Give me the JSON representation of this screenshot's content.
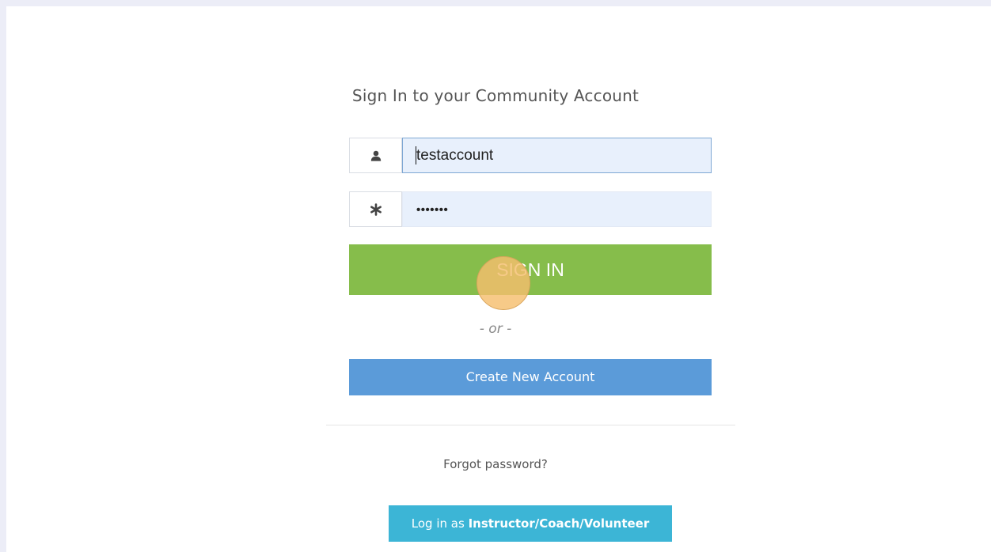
{
  "page": {
    "title": "Sign In to your Community Account"
  },
  "form": {
    "username": {
      "icon": "user-icon",
      "value": "testaccount"
    },
    "password": {
      "icon": "asterisk-icon",
      "masked_value": "•••••••"
    },
    "sign_in_label": "SIGN IN",
    "or_text": "- or -",
    "create_account_label": "Create New Account",
    "forgot_password_label": "Forgot password?",
    "instructor_prefix": "Log in as",
    "instructor_role": "Instructor/Coach/Volunteer"
  },
  "colors": {
    "page_background": "#ecedf7",
    "sign_in_button": "#86bd4b",
    "create_account_button": "#5b9bd9",
    "instructor_button": "#3cb5d6",
    "input_background": "#e8f0fc",
    "click_marker": "#f5be6e"
  }
}
